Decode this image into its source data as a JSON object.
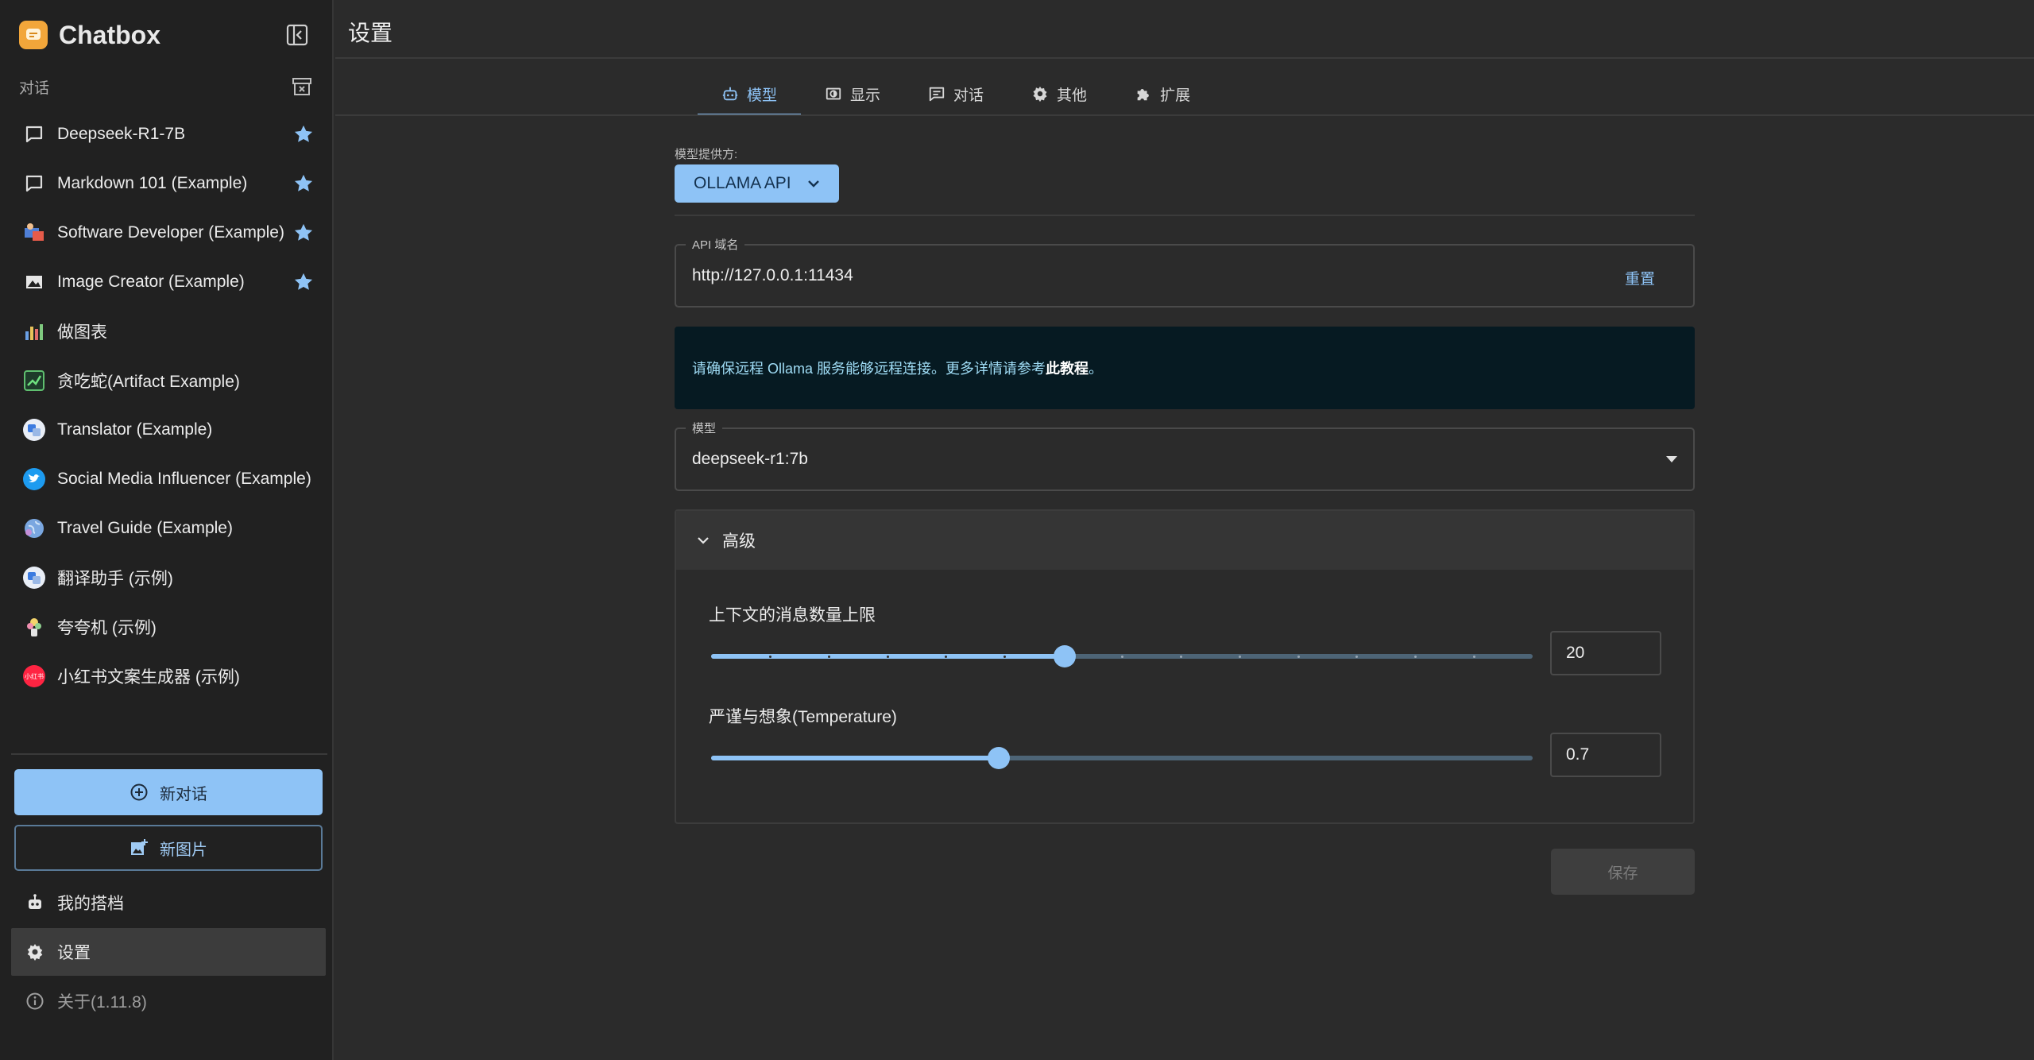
{
  "app": {
    "name": "Chatbox",
    "version_label": "关于(1.11.8)"
  },
  "sidebar": {
    "section_label": "对话",
    "conversations": [
      {
        "label": "Deepseek-R1-7B",
        "icon": "chat-bubble-icon",
        "starred": true
      },
      {
        "label": "Markdown 101 (Example)",
        "icon": "chat-bubble-icon",
        "starred": true
      },
      {
        "label": "Software Developer (Example)",
        "icon": "developer-avatar-icon",
        "starred": true
      },
      {
        "label": "Image Creator (Example)",
        "icon": "image-icon",
        "starred": true
      },
      {
        "label": "做图表",
        "icon": "chart-avatar-icon",
        "starred": false
      },
      {
        "label": "贪吃蛇(Artifact Example)",
        "icon": "snake-game-avatar-icon",
        "starred": false
      },
      {
        "label": "Translator (Example)",
        "icon": "translator-avatar-icon",
        "starred": false
      },
      {
        "label": "Social Media Influencer (Example)",
        "icon": "twitter-avatar-icon",
        "starred": false
      },
      {
        "label": "Travel Guide (Example)",
        "icon": "globe-avatar-icon",
        "starred": false
      },
      {
        "label": "翻译助手 (示例)",
        "icon": "translator-avatar-icon",
        "starred": false
      },
      {
        "label": "夸夸机 (示例)",
        "icon": "flower-avatar-icon",
        "starred": false
      },
      {
        "label": "小红书文案生成器 (示例)",
        "icon": "xiaohongshu-avatar-icon",
        "starred": false
      }
    ],
    "new_chat_label": "新对话",
    "new_image_label": "新图片",
    "partners_label": "我的搭档",
    "settings_label": "设置",
    "xhs_badge": "小红书"
  },
  "header": {
    "title": "设置"
  },
  "tabs": [
    {
      "label": "模型",
      "icon": "robot-icon",
      "active": true
    },
    {
      "label": "显示",
      "icon": "display-icon",
      "active": false
    },
    {
      "label": "对话",
      "icon": "chat-icon",
      "active": false
    },
    {
      "label": "其他",
      "icon": "gear-icon",
      "active": false
    },
    {
      "label": "扩展",
      "icon": "puzzle-icon",
      "active": false
    }
  ],
  "model_settings": {
    "provider_caption": "模型提供方:",
    "provider_value": "OLLAMA API",
    "api_host_label": "API 域名",
    "api_host_value": "http://127.0.0.1:11434",
    "reset_label": "重置",
    "info_text": "请确保远程 Ollama 服务能够远程连接。更多详情请参考",
    "info_link": "此教程",
    "info_end": "。",
    "model_label": "模型",
    "model_value": "deepseek-r1:7b",
    "advanced_label": "高级",
    "context_limit_label": "上下文的消息数量上限",
    "context_limit_value": "20",
    "context_limit_fraction": 0.43,
    "temperature_label": "严谨与想象(Temperature)",
    "temperature_value": "0.7",
    "temperature_fraction": 0.35,
    "save_label": "保存"
  },
  "colors": {
    "accent": "#8ec3f6",
    "background": "#2b2b2b",
    "sidebar": "#212121",
    "info_bg": "#061a22"
  }
}
